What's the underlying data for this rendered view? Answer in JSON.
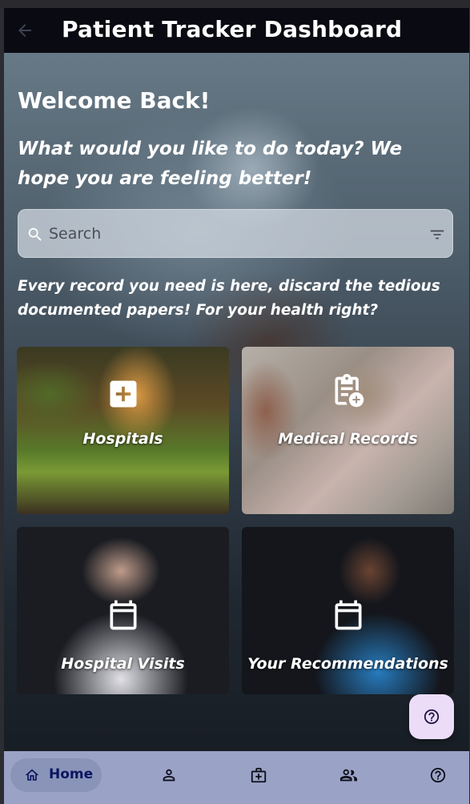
{
  "app_bar": {
    "title": "Patient Tracker Dashboard",
    "back_icon": "arrow-left-icon"
  },
  "greeting": {
    "title": "Welcome Back!",
    "subtitle": "What would you like to do today? We hope you are feeling better!"
  },
  "search": {
    "placeholder": "Search",
    "value": "",
    "leading_icon": "search-icon",
    "trailing_icon": "filter-icon"
  },
  "tagline": "Every record you need is here, discard the tedious documented papers! For your health right?",
  "cards": [
    {
      "label": "Hospitals",
      "icon": "plus-box-icon"
    },
    {
      "label": "Medical Records",
      "icon": "clipboard-plus-icon"
    },
    {
      "label": "Hospital Visits",
      "icon": "calendar-icon"
    },
    {
      "label": "Your Recommendations",
      "icon": "calendar-icon"
    }
  ],
  "fab": {
    "icon": "help-circle-icon"
  },
  "bottom_nav": {
    "items": [
      {
        "label": "Home",
        "icon": "home-icon",
        "active": true
      },
      {
        "label": "",
        "icon": "person-icon"
      },
      {
        "label": "",
        "icon": "medical-kit-icon"
      },
      {
        "label": "",
        "icon": "people-icon"
      },
      {
        "label": "",
        "icon": "help-circle-icon"
      }
    ]
  },
  "colors": {
    "app_bar": "#0a0b12",
    "nav_bar": "#9aa3c6",
    "nav_active_pill": "#8a94b8",
    "nav_active_text": "#0c1660",
    "fab": "#ecdcf8"
  }
}
